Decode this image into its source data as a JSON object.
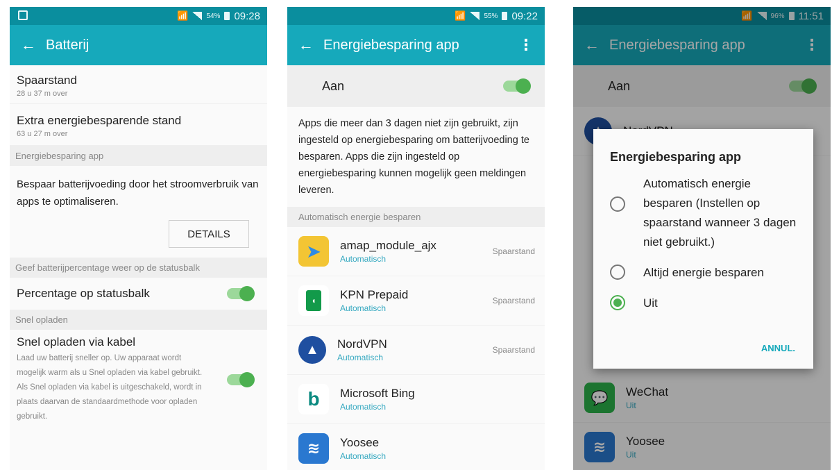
{
  "screens": [
    {
      "status": {
        "pct": "54%",
        "time": "09:28"
      },
      "title": "Batterij",
      "items": [
        {
          "title": "Spaarstand",
          "sub": "28 u 37 m over"
        },
        {
          "title": "Extra energiebesparende stand",
          "sub": "63 u 27 m over"
        }
      ],
      "section1": "Energiebesparing app",
      "description": "Bespaar batterijvoeding door het stroomverbruik van apps te optimaliseren.",
      "details_button": "DETAILS",
      "section2": "Geef batterijpercentage weer op de statusbalk",
      "percentage_label": "Percentage op statusbalk",
      "section3": "Snel opladen",
      "fast_title": "Snel opladen via kabel",
      "fast_desc": "Laad uw batterij sneller op. Uw apparaat wordt mogelijk warm als u Snel opladen via kabel gebruikt. Als Snel opladen via kabel is uitgeschakeld, wordt in plaats daarvan de standaardmethode voor opladen gebruikt."
    },
    {
      "status": {
        "pct": "55%",
        "time": "09:22"
      },
      "title": "Energiebesparing app",
      "master_label": "Aan",
      "description": "Apps die meer dan 3 dagen niet zijn gebruikt, zijn ingesteld op energiebesparing om batterijvoeding te besparen. Apps die zijn ingesteld op energiebesparing kunnen mogelijk geen meldingen leveren.",
      "section": "Automatisch energie besparen",
      "apps": [
        {
          "name": "amap_module_ajx",
          "mode": "Automatisch",
          "state": "Spaarstand",
          "icon": "amap-icon",
          "color": "#2d8be6"
        },
        {
          "name": "KPN Prepaid",
          "mode": "Automatisch",
          "state": "Spaarstand",
          "icon": "kpn-icon",
          "color": "#129a4a"
        },
        {
          "name": "NordVPN",
          "mode": "Automatisch",
          "state": "Spaarstand",
          "icon": "nordvpn-icon",
          "color": "#1f4fa0"
        },
        {
          "name": "Microsoft Bing",
          "mode": "Automatisch",
          "state": "",
          "icon": "bing-icon",
          "color": "#0a8a80"
        },
        {
          "name": "Yoosee",
          "mode": "Automatisch",
          "state": "",
          "icon": "yoosee-icon",
          "color": "#2a78d0"
        }
      ]
    },
    {
      "status": {
        "pct": "96%",
        "time": "11:51"
      },
      "title": "Energiebesparing app",
      "master_label": "Aan",
      "bg_apps": [
        {
          "name": "NordVPN",
          "mode": ""
        },
        {
          "name": "WeChat",
          "mode": "Uit"
        },
        {
          "name": "Yoosee",
          "mode": "Uit"
        }
      ],
      "dialog": {
        "title": "Energiebesparing app",
        "options": [
          {
            "label": "Automatisch energie besparen (Instellen op spaarstand wanneer 3 dagen niet gebruikt.)",
            "selected": false
          },
          {
            "label": "Altijd energie besparen",
            "selected": false
          },
          {
            "label": "Uit",
            "selected": true
          }
        ],
        "cancel": "ANNUL."
      }
    }
  ],
  "colors": {
    "appbar": "#16a9bb",
    "statusbar": "#0a8e9e",
    "accent": "#4cb050"
  }
}
